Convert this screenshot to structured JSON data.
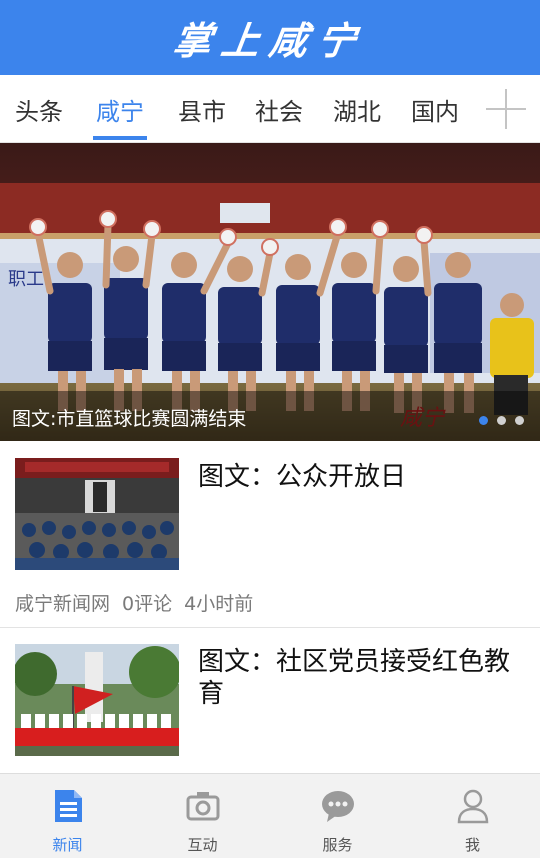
{
  "header": {
    "logo_text": "掌上咸宁"
  },
  "tabs": [
    {
      "label": "头条"
    },
    {
      "label": "咸宁"
    },
    {
      "label": "县市"
    },
    {
      "label": "社会"
    },
    {
      "label": "湖北"
    },
    {
      "label": "国内"
    }
  ],
  "active_tab": "咸宁",
  "banner": {
    "caption": "图文:市直篮球比赛圆满结束",
    "slide_count": 3,
    "active_slide": 1
  },
  "news": [
    {
      "title": "图文：公众开放日",
      "source": "咸宁新闻网",
      "comments": "0评论",
      "time": "4小时前"
    },
    {
      "title": "图文：社区党员接受红色教育"
    }
  ],
  "bottom_nav": [
    {
      "label": "新闻",
      "icon": "news-icon"
    },
    {
      "label": "互动",
      "icon": "camera-icon"
    },
    {
      "label": "服务",
      "icon": "chat-icon"
    },
    {
      "label": "我",
      "icon": "user-icon"
    }
  ],
  "colors": {
    "accent": "#3c84ec",
    "header_bg": "#3c84ec",
    "bottom_bg": "#f2f2f2",
    "inactive_icon": "#9a9a9a"
  }
}
